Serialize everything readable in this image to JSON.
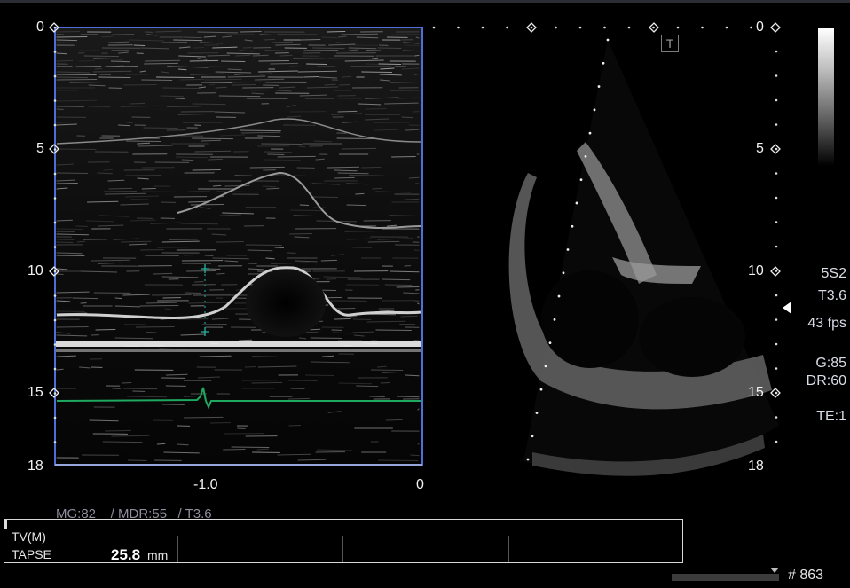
{
  "mmode": {
    "depth_ticks": [
      "0",
      "5",
      "10",
      "15",
      "18"
    ],
    "time_ticks": [
      "-1.0",
      "0"
    ],
    "settings_text": "MG:82    / MDR:55   / T3.6"
  },
  "sector": {
    "depth_ticks": [
      "0",
      "5",
      "10",
      "15",
      "18"
    ],
    "trace_icon": "T"
  },
  "side_panel": {
    "probe": "5S2",
    "mode": "T3.6",
    "fps": "43 fps",
    "gain": "G:85",
    "dynamic_range": "DR:60",
    "te": "TE:1"
  },
  "measurements": {
    "header": "TV(M)",
    "rows": [
      {
        "label": "TAPSE",
        "value": "25.8",
        "unit": "mm"
      }
    ]
  },
  "footer": {
    "frame_number": "# 863"
  },
  "colors": {
    "mmode_border": "#4f6fd8",
    "ecg": "#1fa860",
    "caliper": "#27b5a2",
    "text": "#d9dbe6"
  }
}
